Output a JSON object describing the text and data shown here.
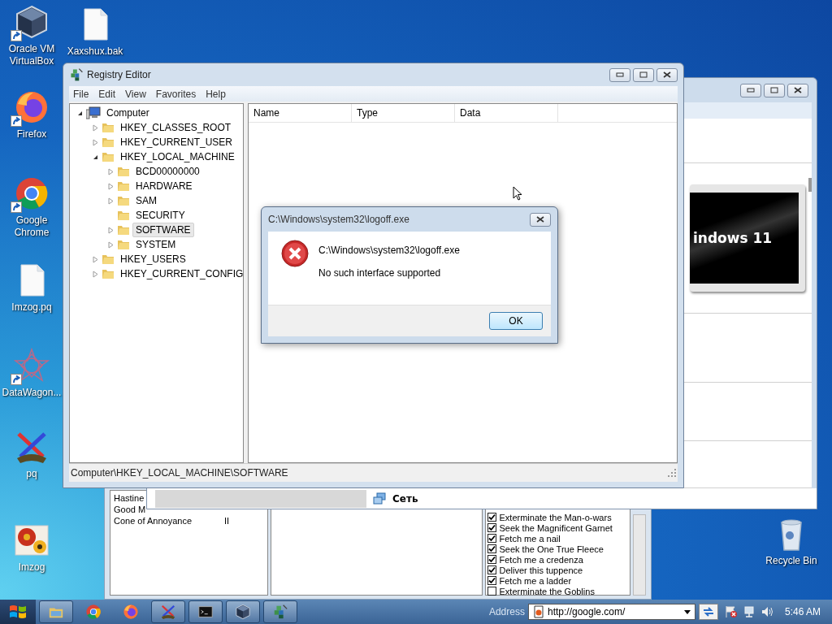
{
  "desktop_icons": [
    {
      "label": "Oracle VM VirtualBox",
      "kind": "virtualbox",
      "shortcut": true
    },
    {
      "label": "Xaxshux.bak",
      "kind": "file",
      "shortcut": false
    },
    {
      "label": "Firefox",
      "kind": "firefox",
      "shortcut": true
    },
    {
      "label": "Google Chrome",
      "kind": "chrome",
      "shortcut": true
    },
    {
      "label": "Imzog.pq",
      "kind": "file",
      "shortcut": false
    },
    {
      "label": "DataWagon...",
      "kind": "datawagon",
      "shortcut": true
    },
    {
      "label": "pq",
      "kind": "swords",
      "shortcut": false
    },
    {
      "label": "Imzog",
      "kind": "flowers",
      "shortcut": false
    },
    {
      "label": "Recycle Bin",
      "kind": "recycle",
      "shortcut": false
    }
  ],
  "game_window": {
    "stats": [
      {
        "name": "Hastine"
      },
      {
        "name": "Good M"
      },
      {
        "name": "Cone of Annoyance",
        "value": "II"
      }
    ],
    "quests": [
      {
        "label": "Exterminate the Man-o-wars",
        "checked": true
      },
      {
        "label": "Seek the Magnificent Garnet",
        "checked": true
      },
      {
        "label": "Fetch me a nail",
        "checked": true
      },
      {
        "label": "Seek the One True Fleece",
        "checked": true
      },
      {
        "label": "Fetch me a credenza",
        "checked": true
      },
      {
        "label": "Deliver this tuppence",
        "checked": true
      },
      {
        "label": "Fetch me a ladder",
        "checked": true
      },
      {
        "label": "Exterminate the Goblins",
        "checked": false
      }
    ]
  },
  "network_window": {
    "banner_text": "indows 11",
    "status_label": "Сеть"
  },
  "registry_editor": {
    "title": "Registry Editor",
    "menu": [
      "File",
      "Edit",
      "View",
      "Favorites",
      "Help"
    ],
    "tree": [
      {
        "label": "Computer",
        "kind": "computer",
        "expandable": true,
        "expanded": true,
        "selected": false,
        "children": [
          {
            "label": "HKEY_CLASSES_ROOT",
            "kind": "folder",
            "expandable": true,
            "expanded": false,
            "selected": false
          },
          {
            "label": "HKEY_CURRENT_USER",
            "kind": "folder",
            "expandable": true,
            "expanded": false,
            "selected": false
          },
          {
            "label": "HKEY_LOCAL_MACHINE",
            "kind": "folder",
            "expandable": true,
            "expanded": true,
            "selected": false,
            "children": [
              {
                "label": "BCD00000000",
                "kind": "folder",
                "expandable": true,
                "expanded": false,
                "selected": false
              },
              {
                "label": "HARDWARE",
                "kind": "folder",
                "expandable": true,
                "expanded": false,
                "selected": false
              },
              {
                "label": "SAM",
                "kind": "folder",
                "expandable": true,
                "expanded": false,
                "selected": false
              },
              {
                "label": "SECURITY",
                "kind": "folder",
                "expandable": false,
                "selected": false
              },
              {
                "label": "SOFTWARE",
                "kind": "folder",
                "expandable": true,
                "expanded": false,
                "selected": true
              },
              {
                "label": "SYSTEM",
                "kind": "folder",
                "expandable": true,
                "expanded": false,
                "selected": false
              }
            ]
          },
          {
            "label": "HKEY_USERS",
            "kind": "folder",
            "expandable": true,
            "expanded": false,
            "selected": false
          },
          {
            "label": "HKEY_CURRENT_CONFIG",
            "kind": "folder",
            "expandable": true,
            "expanded": false,
            "selected": false
          }
        ]
      }
    ],
    "columns": [
      "Name",
      "Type",
      "Data"
    ],
    "status": "Computer\\HKEY_LOCAL_MACHINE\\SOFTWARE"
  },
  "dialog": {
    "title": "C:\\Windows\\system32\\logoff.exe",
    "heading": "C:\\Windows\\system32\\logoff.exe",
    "message": "No such interface supported",
    "button": "OK"
  },
  "taskbar": {
    "buttons": [
      {
        "kind": "explorer",
        "running": true
      },
      {
        "kind": "chrome",
        "running": false
      },
      {
        "kind": "firefox",
        "running": false
      },
      {
        "kind": "swords",
        "running": true
      },
      {
        "kind": "console",
        "running": true
      },
      {
        "kind": "virtualbox",
        "running": true
      },
      {
        "kind": "registry",
        "running": true
      }
    ],
    "address_label": "Address",
    "address": "http://google.com/",
    "clock": "5:46 AM"
  }
}
